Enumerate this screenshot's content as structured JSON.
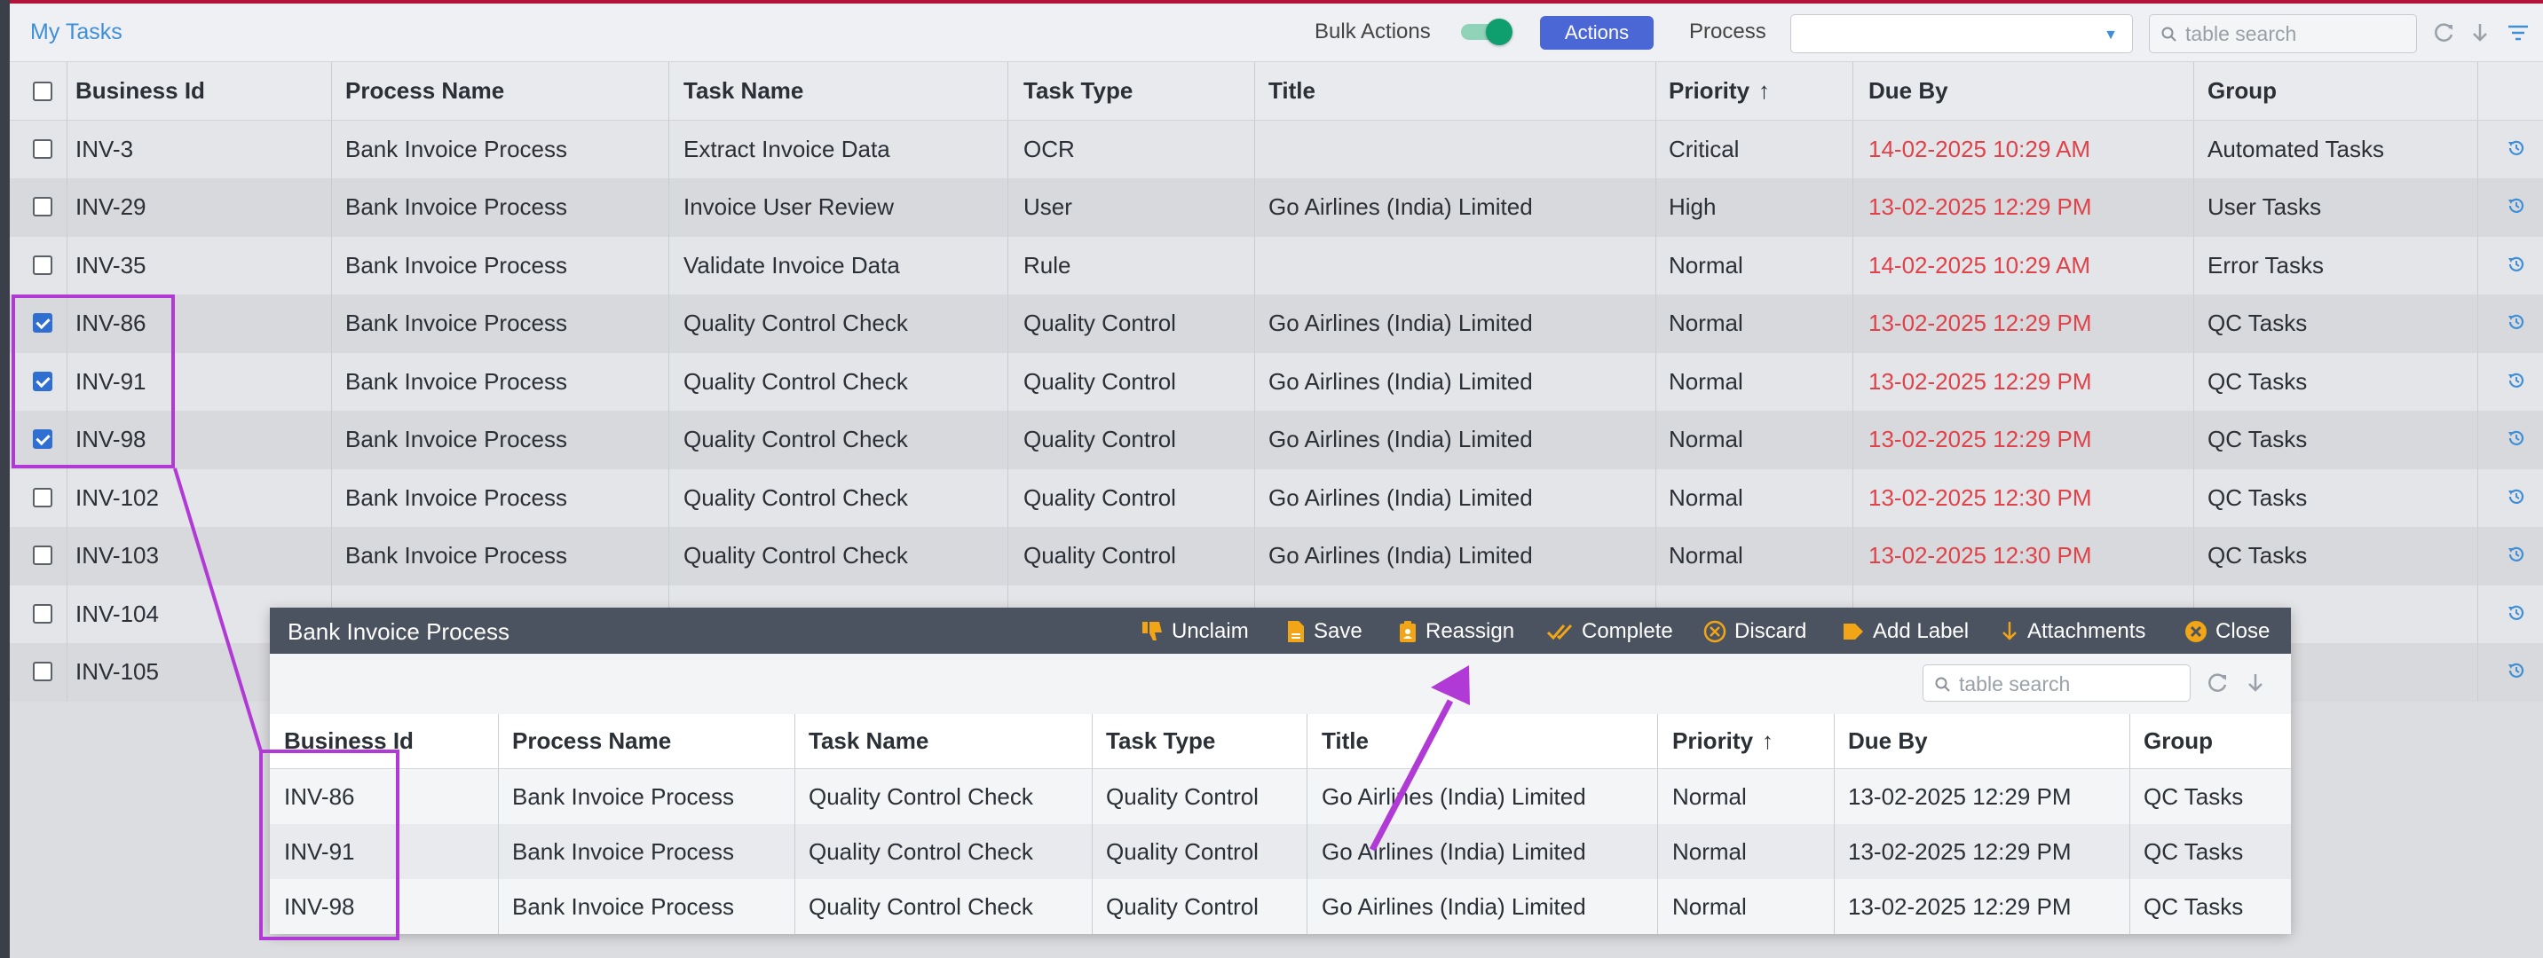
{
  "header": {
    "title": "My Tasks",
    "bulk_actions_label": "Bulk Actions",
    "bulk_actions_on": true,
    "actions_label": "Actions",
    "process_label": "Process",
    "process_value": "",
    "search_placeholder": "table search"
  },
  "table": {
    "columns": [
      "Business Id",
      "Process Name",
      "Task Name",
      "Task Type",
      "Title",
      "Priority",
      "Due By",
      "Group"
    ],
    "sort_column": "Priority",
    "rows": [
      {
        "checked": false,
        "business_id": "INV-3",
        "process_name": "Bank Invoice Process",
        "task_name": "Extract Invoice Data",
        "task_type": "OCR",
        "title": "",
        "priority": "Critical",
        "due_by": "14-02-2025 10:29 AM",
        "group": "Automated Tasks"
      },
      {
        "checked": false,
        "business_id": "INV-29",
        "process_name": "Bank Invoice Process",
        "task_name": "Invoice User Review",
        "task_type": "User",
        "title": "Go Airlines (India) Limited",
        "priority": "High",
        "due_by": "13-02-2025 12:29 PM",
        "group": "User Tasks"
      },
      {
        "checked": false,
        "business_id": "INV-35",
        "process_name": "Bank Invoice Process",
        "task_name": "Validate Invoice Data",
        "task_type": "Rule",
        "title": "",
        "priority": "Normal",
        "due_by": "14-02-2025 10:29 AM",
        "group": "Error Tasks"
      },
      {
        "checked": true,
        "business_id": "INV-86",
        "process_name": "Bank Invoice Process",
        "task_name": "Quality Control Check",
        "task_type": "Quality Control",
        "title": "Go Airlines (India) Limited",
        "priority": "Normal",
        "due_by": "13-02-2025 12:29 PM",
        "group": "QC Tasks"
      },
      {
        "checked": true,
        "business_id": "INV-91",
        "process_name": "Bank Invoice Process",
        "task_name": "Quality Control Check",
        "task_type": "Quality Control",
        "title": "Go Airlines (India) Limited",
        "priority": "Normal",
        "due_by": "13-02-2025 12:29 PM",
        "group": "QC Tasks"
      },
      {
        "checked": true,
        "business_id": "INV-98",
        "process_name": "Bank Invoice Process",
        "task_name": "Quality Control Check",
        "task_type": "Quality Control",
        "title": "Go Airlines (India) Limited",
        "priority": "Normal",
        "due_by": "13-02-2025 12:29 PM",
        "group": "QC Tasks"
      },
      {
        "checked": false,
        "business_id": "INV-102",
        "process_name": "Bank Invoice Process",
        "task_name": "Quality Control Check",
        "task_type": "Quality Control",
        "title": "Go Airlines (India) Limited",
        "priority": "Normal",
        "due_by": "13-02-2025 12:30 PM",
        "group": "QC Tasks"
      },
      {
        "checked": false,
        "business_id": "INV-103",
        "process_name": "Bank Invoice Process",
        "task_name": "Quality Control Check",
        "task_type": "Quality Control",
        "title": "Go Airlines (India) Limited",
        "priority": "Normal",
        "due_by": "13-02-2025 12:30 PM",
        "group": "QC Tasks"
      },
      {
        "checked": false,
        "business_id": "INV-104",
        "process_name": "",
        "task_name": "",
        "task_type": "",
        "title": "",
        "priority": "",
        "due_by": "",
        "group": ""
      },
      {
        "checked": false,
        "business_id": "INV-105",
        "process_name": "",
        "task_name": "",
        "task_type": "",
        "title": "",
        "priority": "",
        "due_by": "",
        "group": ""
      }
    ]
  },
  "panel": {
    "title": "Bank Invoice Process",
    "buttons": [
      "Unclaim",
      "Save",
      "Reassign",
      "Complete",
      "Discard",
      "Add Label",
      "Attachments",
      "Close"
    ],
    "search_placeholder": "table search",
    "columns": [
      "Business Id",
      "Process Name",
      "Task Name",
      "Task Type",
      "Title",
      "Priority",
      "Due By",
      "Group"
    ],
    "rows": [
      {
        "business_id": "INV-86",
        "process_name": "Bank Invoice Process",
        "task_name": "Quality Control Check",
        "task_type": "Quality Control",
        "title": "Go Airlines (India) Limited",
        "priority": "Normal",
        "due_by": "13-02-2025 12:29 PM",
        "group": "QC Tasks"
      },
      {
        "business_id": "INV-91",
        "process_name": "Bank Invoice Process",
        "task_name": "Quality Control Check",
        "task_type": "Quality Control",
        "title": "Go Airlines (India) Limited",
        "priority": "Normal",
        "due_by": "13-02-2025 12:29 PM",
        "group": "QC Tasks"
      },
      {
        "business_id": "INV-98",
        "process_name": "Bank Invoice Process",
        "task_name": "Quality Control Check",
        "task_type": "Quality Control",
        "title": "Go Airlines (India) Limited",
        "priority": "Normal",
        "due_by": "13-02-2025 12:29 PM",
        "group": "QC Tasks"
      }
    ]
  },
  "colors": {
    "accent": "#4b67d6",
    "due_overdue": "#e0424a",
    "annotation": "#b13ad6",
    "toggle_on": "#0f9e6e"
  },
  "icons": {
    "toolbar": [
      "search-icon",
      "refresh-icon",
      "download-icon",
      "filter-icon"
    ],
    "row_action": "history-icon",
    "panel": [
      "thumbs-down-icon",
      "save-icon",
      "reassign-icon",
      "complete-icon",
      "discard-icon",
      "label-icon",
      "attachments-icon",
      "close-icon"
    ]
  }
}
